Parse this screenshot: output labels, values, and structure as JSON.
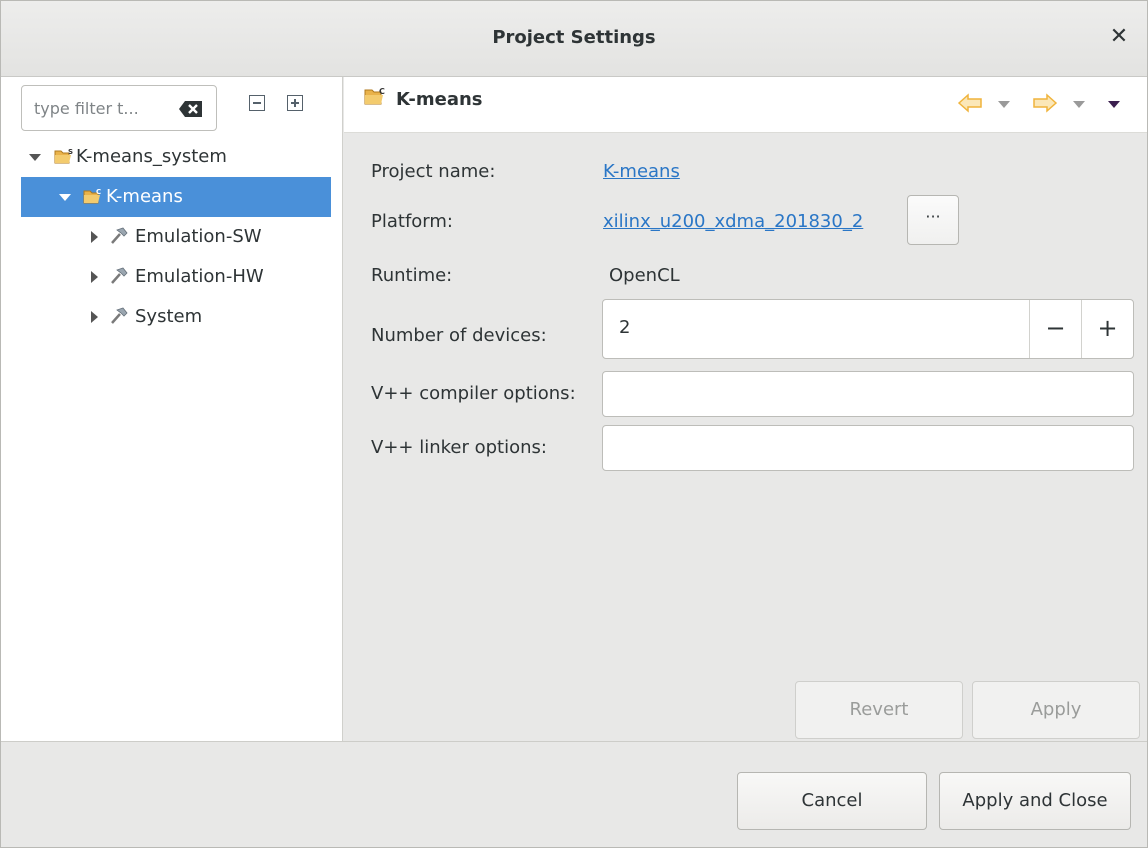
{
  "window": {
    "title": "Project Settings"
  },
  "filter": {
    "placeholder": "type filter t..."
  },
  "tree": {
    "items": [
      {
        "label": "K-means_system",
        "expanded": true,
        "selected": false,
        "icon": "system-project-icon"
      },
      {
        "label": "K-means",
        "expanded": true,
        "selected": true,
        "icon": "c-project-icon"
      },
      {
        "label": "Emulation-SW",
        "expanded": false,
        "selected": false,
        "icon": "build-hammer-icon"
      },
      {
        "label": "Emulation-HW",
        "expanded": false,
        "selected": false,
        "icon": "build-hammer-icon"
      },
      {
        "label": "System",
        "expanded": false,
        "selected": false,
        "icon": "build-hammer-icon"
      }
    ]
  },
  "page": {
    "title": "K-means"
  },
  "form": {
    "project_name_label": "Project name:",
    "project_name_value": "K-means",
    "platform_label": "Platform:",
    "platform_value": "xilinx_u200_xdma_201830_2",
    "platform_browse_label": "···",
    "runtime_label": "Runtime:",
    "runtime_value": "OpenCL",
    "devices_label": "Number of devices:",
    "devices_value": "2",
    "devices_decrement": "−",
    "devices_increment": "+",
    "compiler_label": "V++ compiler options:",
    "compiler_value": "",
    "linker_label": "V++ linker options:",
    "linker_value": ""
  },
  "buttons": {
    "revert": "Revert",
    "apply": "Apply",
    "cancel": "Cancel",
    "apply_close": "Apply and Close"
  },
  "colors": {
    "selection": "#4a90d9",
    "link": "#2a76c6",
    "nav_arrow": "#f0b43c"
  }
}
